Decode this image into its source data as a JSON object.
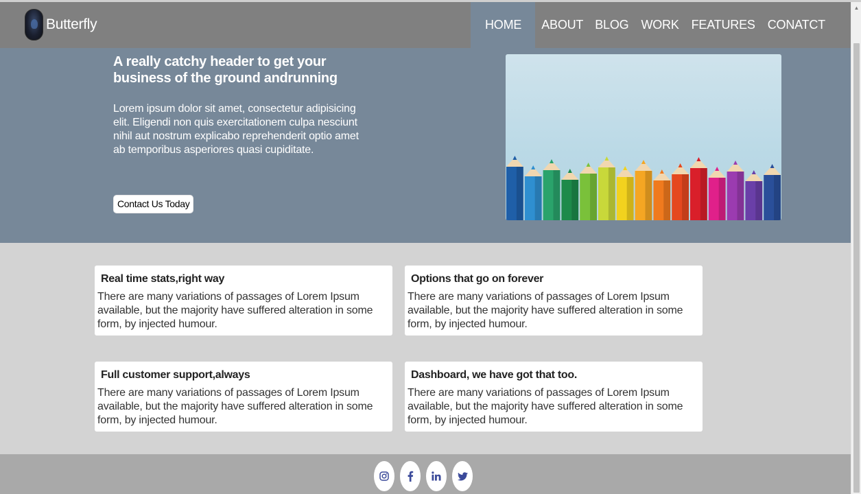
{
  "nav": {
    "brand": "Butterfly",
    "links": [
      "HOME",
      "ABOUT",
      "BLOG",
      "WORK",
      "FEATURES",
      "CONATCT"
    ],
    "active": "HOME"
  },
  "hero": {
    "title": "A really catchy header to get your business of the ground andrunning",
    "text": "Lorem ipsum dolor sit amet, consectetur adipisicing elit. Eligendi non quis exercitationem culpa nesciunt nihil aut nostrum explicabo reprehenderit optio amet ab temporibus asperiores quasi cupiditate.",
    "button": "Contact Us Today",
    "image": "colored-pencils-image"
  },
  "features": [
    {
      "title": "Real time stats,right way",
      "text": "There are many variations of passages of Lorem Ipsum available, but the majority have suffered alteration in some form, by injected humour."
    },
    {
      "title": "Options that go on forever",
      "text": "There are many variations of passages of Lorem Ipsum available, but the majority have suffered alteration in some form, by injected humour."
    },
    {
      "title": "Full customer support,always",
      "text": "There are many variations of passages of Lorem Ipsum available, but the majority have suffered alteration in some form, by injected humour."
    },
    {
      "title": "Dashboard, we have got that too.",
      "text": "There are many variations of passages of Lorem Ipsum available, but the majority have suffered alteration in some form, by injected humour."
    }
  ],
  "footer": {
    "socials": [
      "instagram-icon",
      "facebook-icon",
      "linkedin-icon",
      "twitter-icon"
    ]
  },
  "colors": {
    "nav_bg": "#808080",
    "nav_active_bg": "#778899",
    "hero_bg": "#778899",
    "section_bg": "#d3d3d3",
    "footer_bg": "#a9a9a9",
    "social_icon": "#3b4a9a"
  }
}
